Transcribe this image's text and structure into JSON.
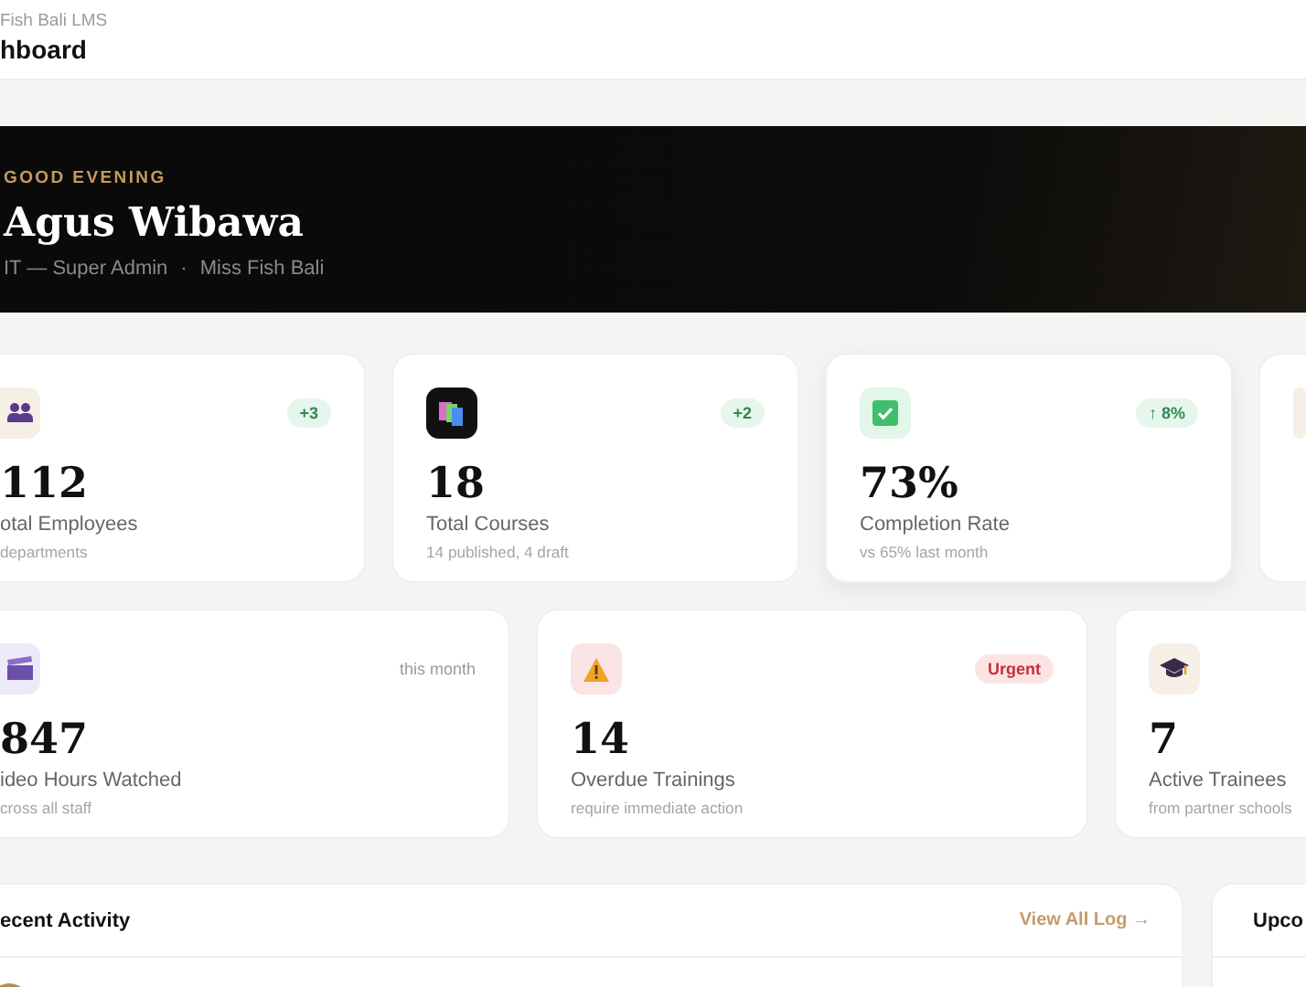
{
  "header": {
    "app_name": "Fish Bali LMS",
    "title": "hboard"
  },
  "hero": {
    "greeting": "GOOD EVENING",
    "name": "Agus Wibawa",
    "role": "IT — Super Admin",
    "company": "Miss Fish Bali",
    "separator": "·"
  },
  "stats_row_1": [
    {
      "kind": "people",
      "badge": {
        "text": "+3",
        "kind": "positive"
      },
      "value": "112",
      "label": "otal Employees",
      "note": "departments",
      "elevated": false
    },
    {
      "kind": "books",
      "badge": {
        "text": "+2",
        "kind": "positive"
      },
      "value": "18",
      "label": "Total Courses",
      "note": "14 published, 4 draft",
      "elevated": false
    },
    {
      "kind": "check",
      "badge": {
        "text": "↑ 8%",
        "kind": "positive"
      },
      "value": "73%",
      "label": "Completion Rate",
      "note": "vs 65% last month",
      "elevated": true
    },
    {
      "kind": "blank",
      "elevated": false
    }
  ],
  "stats_row_2": [
    {
      "kind": "clapper",
      "badge": {
        "text": "this month",
        "kind": "plain"
      },
      "value": "847",
      "label": "ideo Hours Watched",
      "note": "cross all staff",
      "elevated": false
    },
    {
      "kind": "warning",
      "badge": {
        "text": "Urgent",
        "kind": "danger"
      },
      "value": "14",
      "label": "Overdue Trainings",
      "note": "require immediate action",
      "elevated": false
    },
    {
      "kind": "cap",
      "value": "7",
      "label": "Active Trainees",
      "note": "from partner schools",
      "elevated": false
    }
  ],
  "recent_activity": {
    "title": "ecent Activity",
    "link": "View All Log →"
  },
  "upcoming": {
    "title": "Upco"
  }
}
